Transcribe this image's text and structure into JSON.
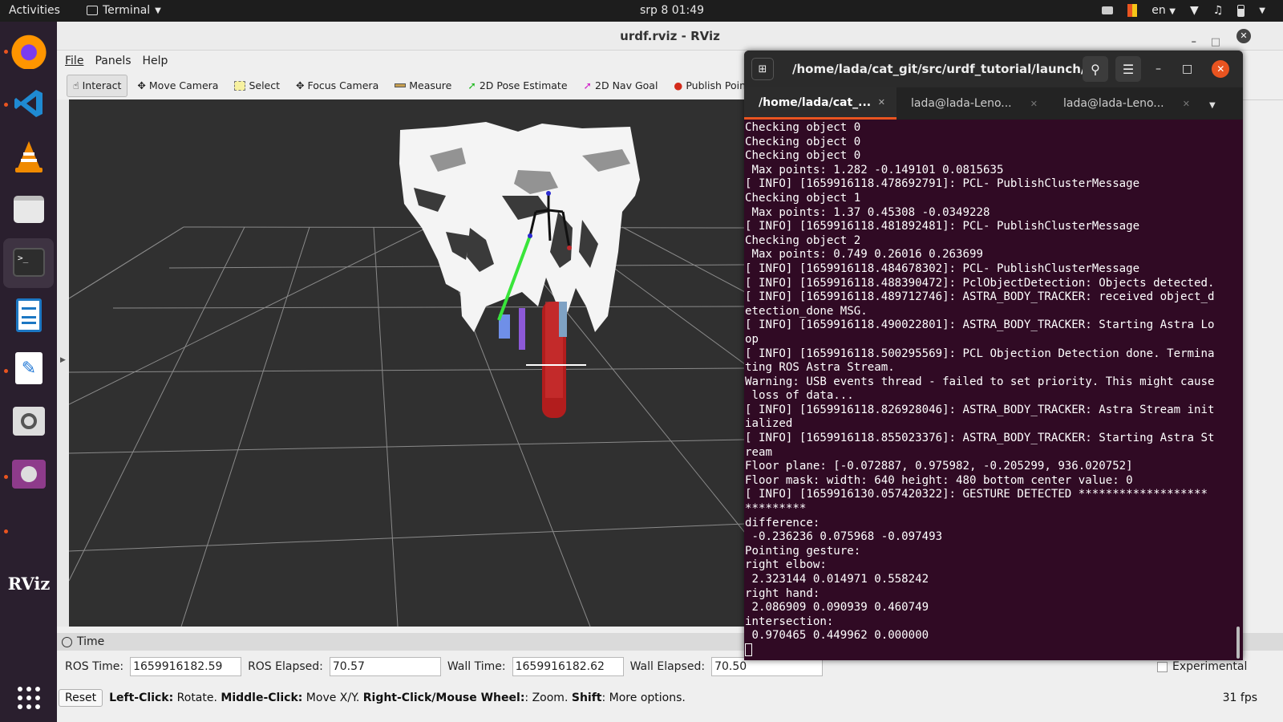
{
  "topbar": {
    "activities": "Activities",
    "app_name": "Terminal",
    "clock": "srp 8  01:49",
    "language": "en"
  },
  "dock": {
    "items": [
      {
        "name": "Firefox"
      },
      {
        "name": "Visual Studio Code"
      },
      {
        "name": "VLC"
      },
      {
        "name": "Files"
      },
      {
        "name": "Terminal"
      },
      {
        "name": "LibreOffice Writer"
      },
      {
        "name": "Text Editor"
      },
      {
        "name": "Image Viewer"
      },
      {
        "name": "Videos"
      },
      {
        "name": "RViz"
      }
    ],
    "rviz_label": "RViz"
  },
  "rviz": {
    "title": "urdf.rviz - RViz",
    "menu": [
      "File",
      "Panels",
      "Help"
    ],
    "tools": [
      "Interact",
      "Move Camera",
      "Select",
      "Focus Camera",
      "Measure",
      "2D Pose Estimate",
      "2D Nav Goal",
      "Publish Point"
    ],
    "time_panel": {
      "title": "Time",
      "ros_time_label": "ROS Time:",
      "ros_time_value": "1659916182.59",
      "ros_elapsed_label": "ROS Elapsed:",
      "ros_elapsed_value": "70.57",
      "wall_time_label": "Wall Time:",
      "wall_time_value": "1659916182.62",
      "wall_elapsed_label": "Wall Elapsed:",
      "wall_elapsed_value": "70.50",
      "experimental_label": "Experimental"
    },
    "status": {
      "reset": "Reset",
      "b1": "Left-Click:",
      "t1": " Rotate. ",
      "b2": "Middle-Click:",
      "t2": " Move X/Y. ",
      "b3": "Right-Click/Mouse Wheel:",
      "t3": ": Zoom. ",
      "b4": "Shift",
      "t4": ": More options.",
      "fps": "31 fps"
    }
  },
  "terminal": {
    "title": "/home/lada/cat_git/src/urdf_tutorial/launch/u...",
    "tabs": [
      "/home/lada/cat_...",
      "lada@lada-Leno...",
      "lada@lada-Leno..."
    ],
    "lines": [
      "Checking object 0",
      "Checking object 0",
      "Checking object 0",
      " Max points: 1.282 -0.149101 0.0815635",
      "[ INFO] [1659916118.478692791]: PCL- PublishClusterMessage",
      "Checking object 1",
      " Max points: 1.37 0.45308 -0.0349228",
      "[ INFO] [1659916118.481892481]: PCL- PublishClusterMessage",
      "Checking object 2",
      " Max points: 0.749 0.26016 0.263699",
      "[ INFO] [1659916118.484678302]: PCL- PublishClusterMessage",
      "[ INFO] [1659916118.488390472]: PclObjectDetection: Objects detected.",
      "[ INFO] [1659916118.489712746]: ASTRA_BODY_TRACKER: received object_d",
      "etection_done MSG.",
      "[ INFO] [1659916118.490022801]: ASTRA_BODY_TRACKER: Starting Astra Lo",
      "op",
      "[ INFO] [1659916118.500295569]: PCL Objection Detection done. Termina",
      "ting ROS Astra Stream.",
      "Warning: USB events thread - failed to set priority. This might cause",
      " loss of data...",
      "[ INFO] [1659916118.826928046]: ASTRA_BODY_TRACKER: Astra Stream init",
      "ialized",
      "[ INFO] [1659916118.855023376]: ASTRA_BODY_TRACKER: Starting Astra St",
      "ream",
      "Floor plane: [-0.072887, 0.975982, -0.205299, 936.020752]",
      "Floor mask: width: 640 height: 480 bottom center value: 0",
      "[ INFO] [1659916130.057420322]: GESTURE DETECTED *******************",
      "*********",
      "difference:",
      " -0.236236 0.075968 -0.097493",
      "Pointing gesture:",
      "right elbow:",
      " 2.323144 0.014971 0.558242",
      "right hand:",
      " 2.086909 0.090939 0.460749",
      "intersection:",
      " 0.970465 0.449962 0.000000"
    ]
  }
}
